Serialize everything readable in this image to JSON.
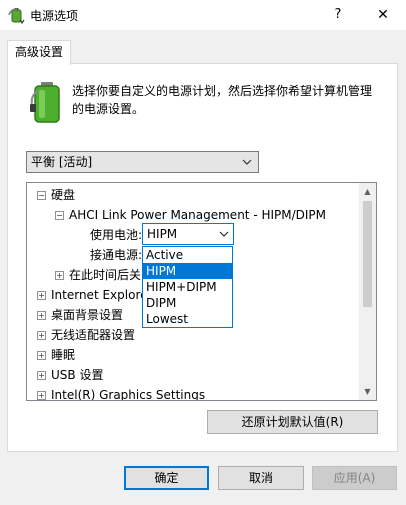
{
  "window": {
    "title": "电源选项",
    "help_label": "?",
    "close_label": "✕"
  },
  "tab": {
    "label": "高级设置"
  },
  "description": "选择你要自定义的电源计划，然后选择你希望计算机管理的电源设置。",
  "plan_select": {
    "value": "平衡 [活动]"
  },
  "tree": {
    "hard_disk": "硬盘",
    "ahci": "AHCI Link Power Management - HIPM/DIPM",
    "on_battery": "使用电池:",
    "plugged_in": "接通电源:",
    "after_time": "在此时间后关",
    "ie": "Internet Explorer",
    "desktop_bg": "桌面背景设置",
    "wireless": "无线适配器设置",
    "sleep": "睡眠",
    "usb": "USB 设置",
    "intel": "Intel(R) Graphics Settings"
  },
  "setting_select": {
    "value": "HIPM"
  },
  "dropdown_options": [
    "Active",
    "HIPM",
    "HIPM+DIPM",
    "DIPM",
    "Lowest"
  ],
  "dropdown_selected": "HIPM",
  "buttons": {
    "restore": "还原计划默认值(R)",
    "ok": "确定",
    "cancel": "取消",
    "apply": "应用(A)"
  },
  "colors": {
    "accent": "#0078d7",
    "battery": "#4caf2e"
  },
  "icons": {
    "app": "power-options-icon",
    "battery": "battery-icon"
  }
}
